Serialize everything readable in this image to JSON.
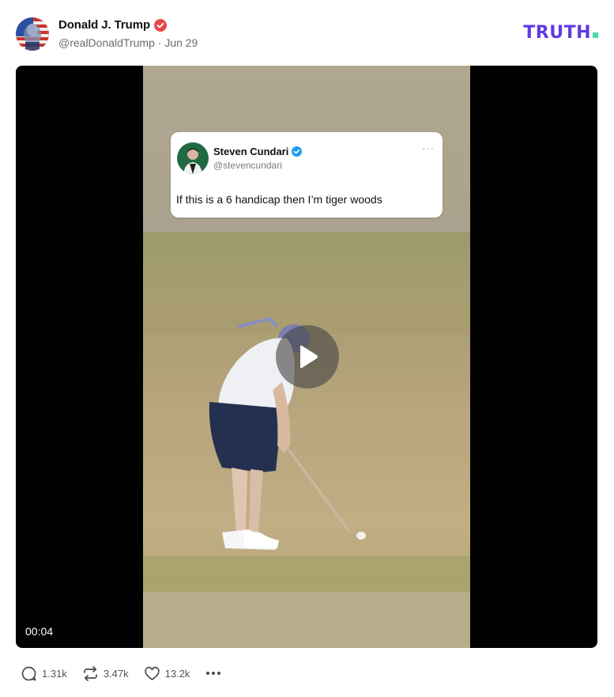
{
  "post": {
    "author": {
      "display_name": "Donald J. Trump",
      "handle": "@realDonaldTrump",
      "separator": "·",
      "date": "Jun 29",
      "avatar_icon": "flag-portrait-avatar",
      "verified_icon": "verified-badge-icon",
      "verified_color": "#e5484d"
    },
    "brand": {
      "logo_text": "TRUTH",
      "logo_color": "#5e3ae3",
      "logo_dot_color": "#46d9a3"
    },
    "video": {
      "duration": "00:04",
      "play_icon": "play-icon",
      "embedded_tweet": {
        "name": "Steven Cundari",
        "handle": "@stevencundari",
        "text": "If this is a 6 handicap then I’m tiger woods",
        "more": "···",
        "verified_color": "#1d9bf0"
      }
    },
    "actions": {
      "replies": {
        "icon": "reply-icon",
        "count": "1.31k"
      },
      "retruths": {
        "icon": "retruth-icon",
        "count": "3.47k"
      },
      "likes": {
        "icon": "heart-icon",
        "count": "13.2k"
      },
      "more": {
        "icon": "more-icon"
      }
    }
  }
}
